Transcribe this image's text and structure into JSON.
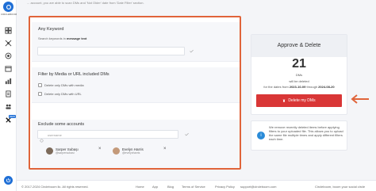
{
  "sidebar": {
    "logo_text": "CIRCLEBOOM",
    "x_badge": "NEW"
  },
  "top_strip": "... account, you are able to scan DMs and 'Not Older' date from 'Date Filter' section.",
  "keyword_section": {
    "title": "Any Keyword",
    "hint_prefix": "Search keywords in",
    "hint_bold": "message text",
    "input_placeholder": ""
  },
  "media_section": {
    "title": "Filter by Media or URL included DMs",
    "options": [
      "Delete only DMs with media",
      "Delete only DMs with URL"
    ]
  },
  "exclude_section": {
    "title": "Exclude some accounts",
    "input_placeholder": "username",
    "users": [
      {
        "name": "Sarper Subaşı",
        "handle": "@sarpersubasi"
      },
      {
        "name": "Evelyn Harris",
        "handle": "@evelynharris"
      }
    ]
  },
  "summary": {
    "title": "Approve & Delete",
    "count": "21",
    "unit": "DMs",
    "will_be": "will be deleted",
    "date_prefix": "for the dates from",
    "date_from": "2023-10-09",
    "date_mid": "through",
    "date_to": "2024-08-20",
    "button_label": "Delete my DMs"
  },
  "info": {
    "text": "We remove recently deleted items before applying filters to your uploaded file. This allows you to upload the same file multiple times and apply different filters each time."
  },
  "footer": {
    "copyright": "© 2017-2024 Circleboom llc. All rights reserved.",
    "links": [
      "Home",
      "App",
      "Blog",
      "Terms of Service",
      "Privacy Policy"
    ],
    "email": "support@circleboom.com",
    "tagline": "Circleboom, boom your social circle"
  },
  "colors": {
    "accent": "#1f6fd6",
    "danger": "#d93636",
    "highlight_border": "#e0643a"
  }
}
